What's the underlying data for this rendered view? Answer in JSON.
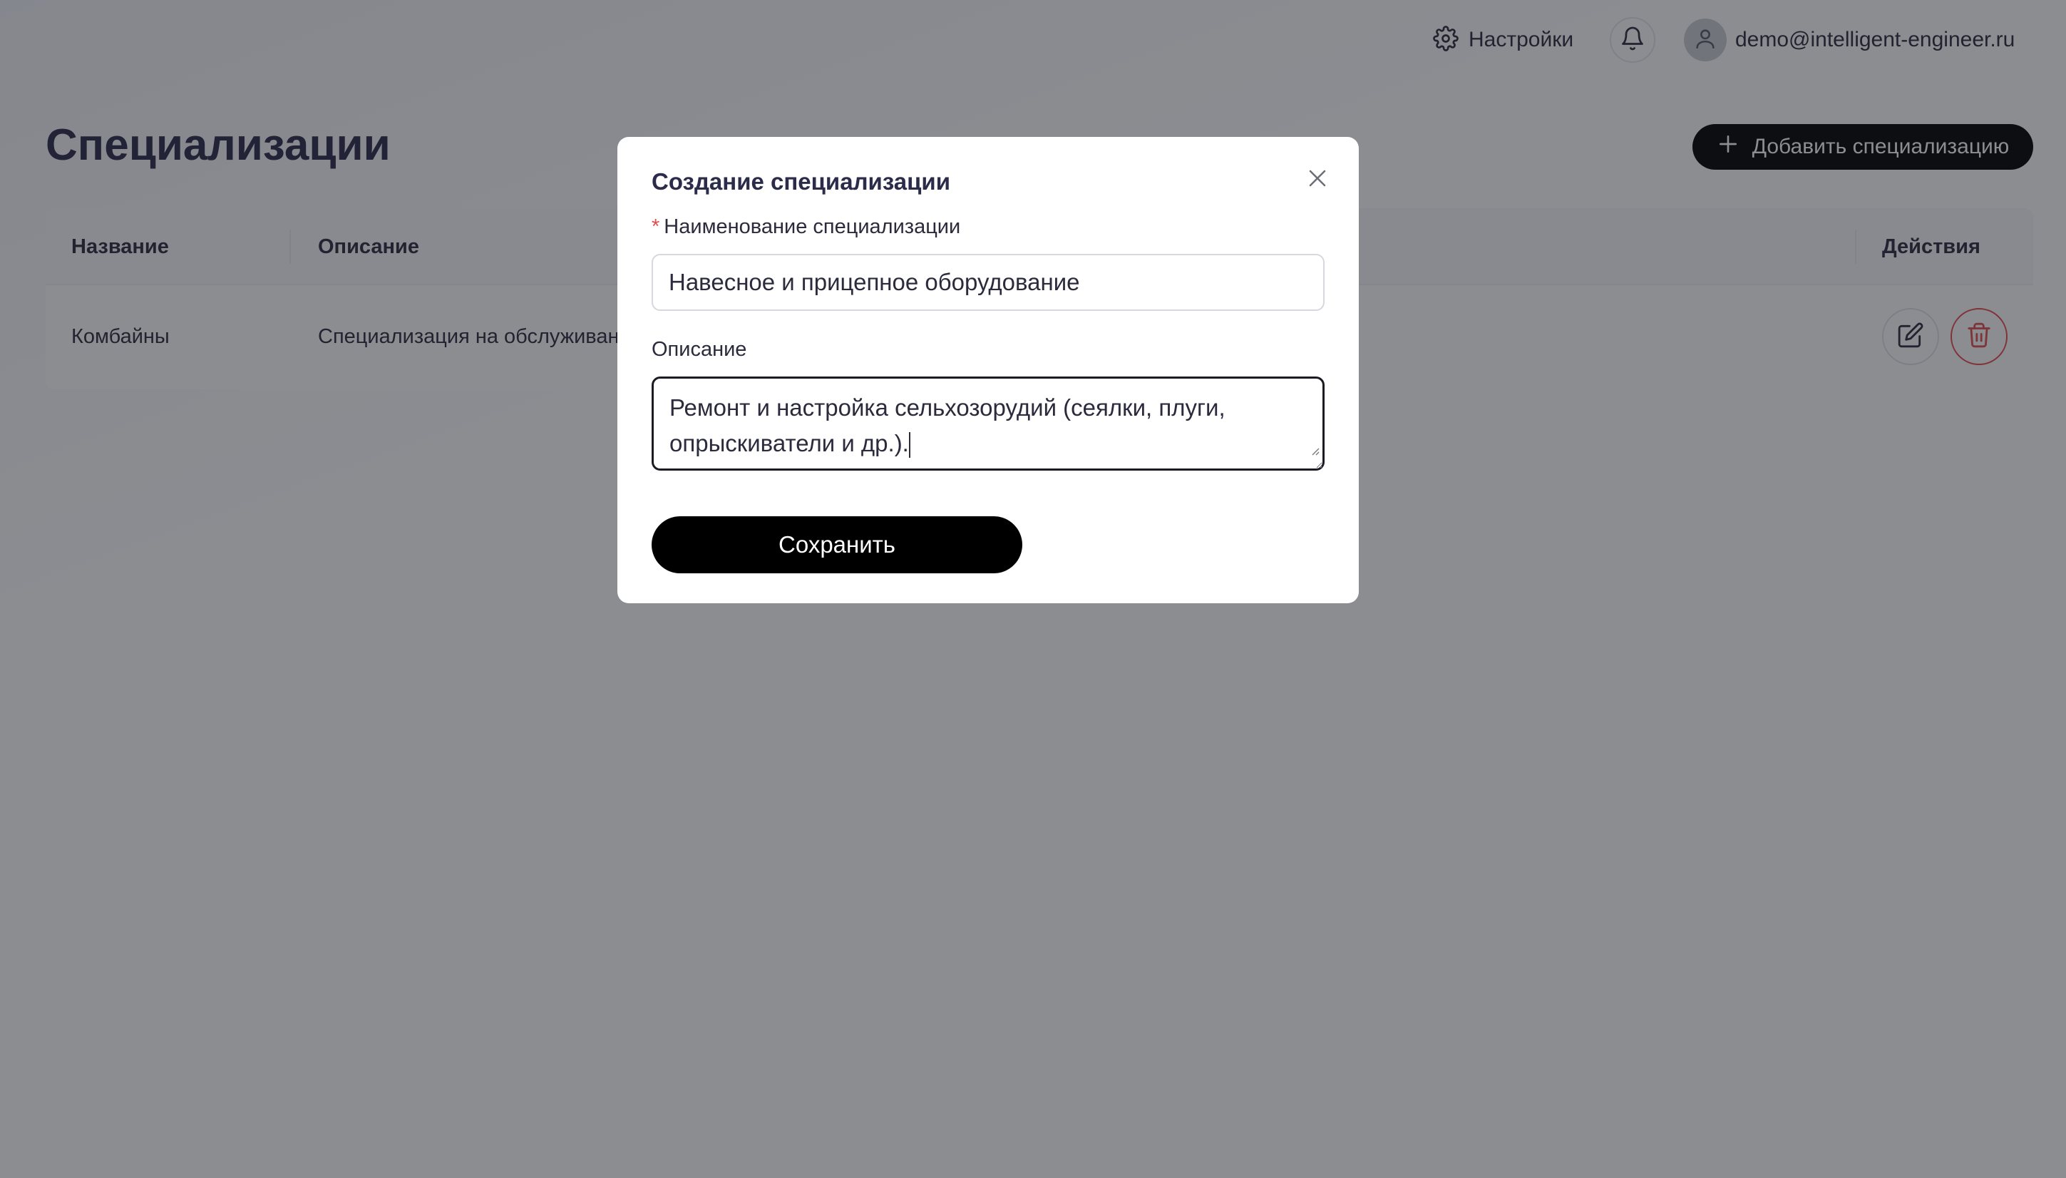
{
  "header": {
    "settings_label": "Настройки",
    "user_email": "demo@intelligent-engineer.ru",
    "icons": [
      "gear-icon",
      "bell-icon",
      "user-icon"
    ]
  },
  "page": {
    "title": "Специализации",
    "add_button_label": "Добавить специализацию"
  },
  "table": {
    "columns": [
      "Название",
      "Описание",
      "Действия"
    ],
    "rows": [
      {
        "name": "Комбайны",
        "description": "Специализация на обслуживан"
      }
    ]
  },
  "modal": {
    "title": "Создание специализации",
    "name_label": "Наименование специализации",
    "required_mark": "*",
    "name_value": "Навесное и прицепное оборудование",
    "description_label": "Описание",
    "description_value": "Ремонт и настройка сельхозорудий (сеялки, плуги, опрыскиватели и др.).",
    "save_label": "Сохранить"
  },
  "colors": {
    "primary": "#000000",
    "danger": "#e34c4c",
    "text": "#2b2b3d"
  }
}
